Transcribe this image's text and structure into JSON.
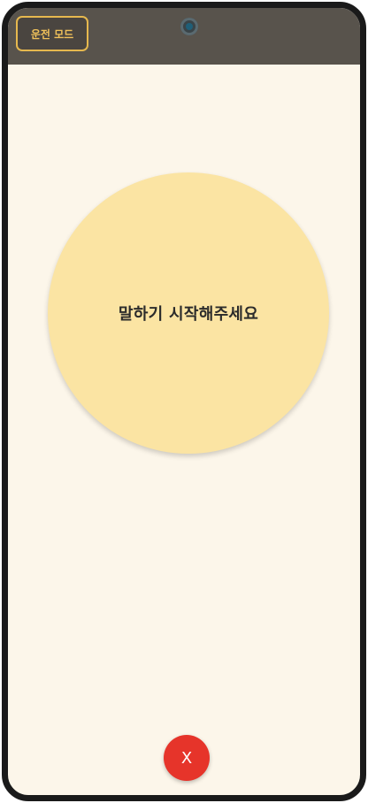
{
  "header": {
    "mode_button_label": "운전 모드"
  },
  "main": {
    "prompt_text": "말하기 시작해주세요"
  },
  "footer": {
    "close_label": "X"
  },
  "icons": {
    "camera": "front-camera-icon"
  },
  "colors": {
    "topbar": "#58534c",
    "background": "#fcf6ea",
    "accent_gold": "#e6b84e",
    "circle": "#fbe4a3",
    "close_button": "#e6342a"
  }
}
